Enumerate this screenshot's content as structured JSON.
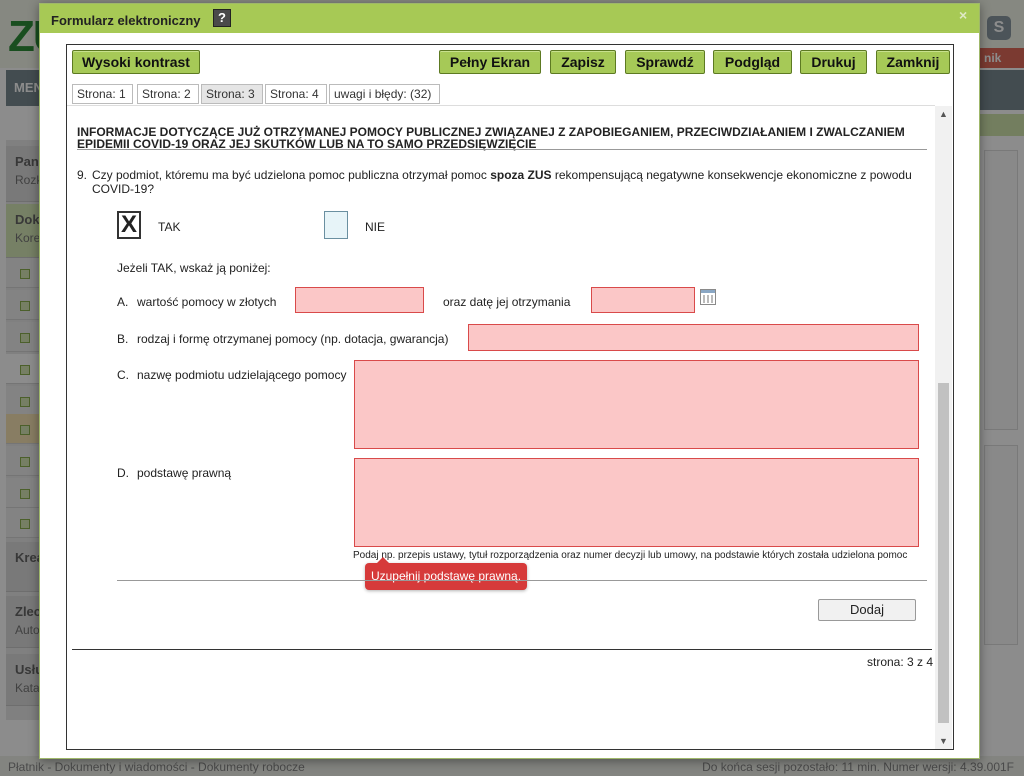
{
  "background": {
    "logo_text": "ZU",
    "menu_label": "MENU",
    "skype_letter": "S",
    "right_badge": "nik",
    "sidebar": [
      {
        "title": "Panel",
        "sub": "Rozkład"
      },
      {
        "title": "Dokumenty",
        "sub": "Korespondencja"
      },
      {
        "title": "Kreator",
        "sub": ""
      },
      {
        "title": "Zlecenia",
        "sub": "Automatyczne"
      },
      {
        "title": "Usługi",
        "sub": "Katalog"
      }
    ],
    "status_left": "Płatnik - Dokumenty i wiadomości - Dokumenty robocze",
    "status_right": "Do końca sesji pozostało: 11 min.    Numer wersji: 4.39.001F"
  },
  "dialog": {
    "title": "Formularz elektroniczny",
    "help_icon": "?",
    "close_icon": "×"
  },
  "toolbar": {
    "high_contrast": "Wysoki kontrast",
    "fullscreen": "Pełny Ekran",
    "save": "Zapisz",
    "check": "Sprawdź",
    "preview": "Podgląd",
    "print": "Drukuj",
    "close": "Zamknij"
  },
  "tabs": [
    {
      "label": "Strona: 1",
      "active": false
    },
    {
      "label": "Strona: 2",
      "active": false
    },
    {
      "label": "Strona: 3",
      "active": true
    },
    {
      "label": "Strona: 4",
      "active": false
    },
    {
      "label": "uwagi i błędy: (32)",
      "active": false
    }
  ],
  "form": {
    "section_heading": "INFORMACJE DOTYCZĄCE JUŻ OTRZYMANEJ POMOCY PUBLICZNEJ ZWIĄZANEJ Z ZAPOBIEGANIEM, PRZECIWDZIAŁANIEM I ZWALCZANIEM EPIDEMII COVID-19 ORAZ JEJ SKUTKÓW LUB NA TO SAMO PRZEDSIĘWZIĘCIE",
    "question_number": "9.",
    "question_text_before": "Czy podmiot, któremu ma być udzielona pomoc publiczna otrzymał pomoc ",
    "question_text_bold": "spoza ZUS",
    "question_text_after": " rekompensującą negatywne konsekwencje ekonomiczne z powodu COVID-19?",
    "option_yes": "TAK",
    "option_yes_checked": true,
    "option_yes_mark": "X",
    "option_no": "NIE",
    "option_no_checked": false,
    "if_yes": "Jeżeli TAK, wskaż ją poniżej:",
    "a_letter": "A.",
    "a_label": "wartość pomocy w złotych",
    "a_date_label": "oraz datę jej otrzymania",
    "a_value": "",
    "a_date": "",
    "b_letter": "B.",
    "b_label": "rodzaj i formę otrzymanej pomocy (np. dotacja, gwarancja)",
    "b_value": "",
    "c_letter": "C.",
    "c_label": "nazwę podmiotu udzielającego pomocy",
    "c_value": "",
    "d_letter": "D.",
    "d_label": "podstawę prawną",
    "d_value": "",
    "d_hint": "Podaj np. przepis ustawy, tytuł rozporządzenia oraz numer decyzji lub umowy, na podstawie których została udzielona pomoc",
    "d_error_tooltip": "Uzupełnij podstawę prawną.",
    "add_button": "Dodaj",
    "page_indicator": "strona: 3 z 4"
  },
  "scrollbar": {
    "up_arrow": "▲",
    "down_arrow": "▼"
  },
  "colors": {
    "accent_green": "#a6c957",
    "field_error_bg": "#fbc7c7",
    "field_error_border": "#d94a4a",
    "tooltip_red": "#d63a3a"
  }
}
